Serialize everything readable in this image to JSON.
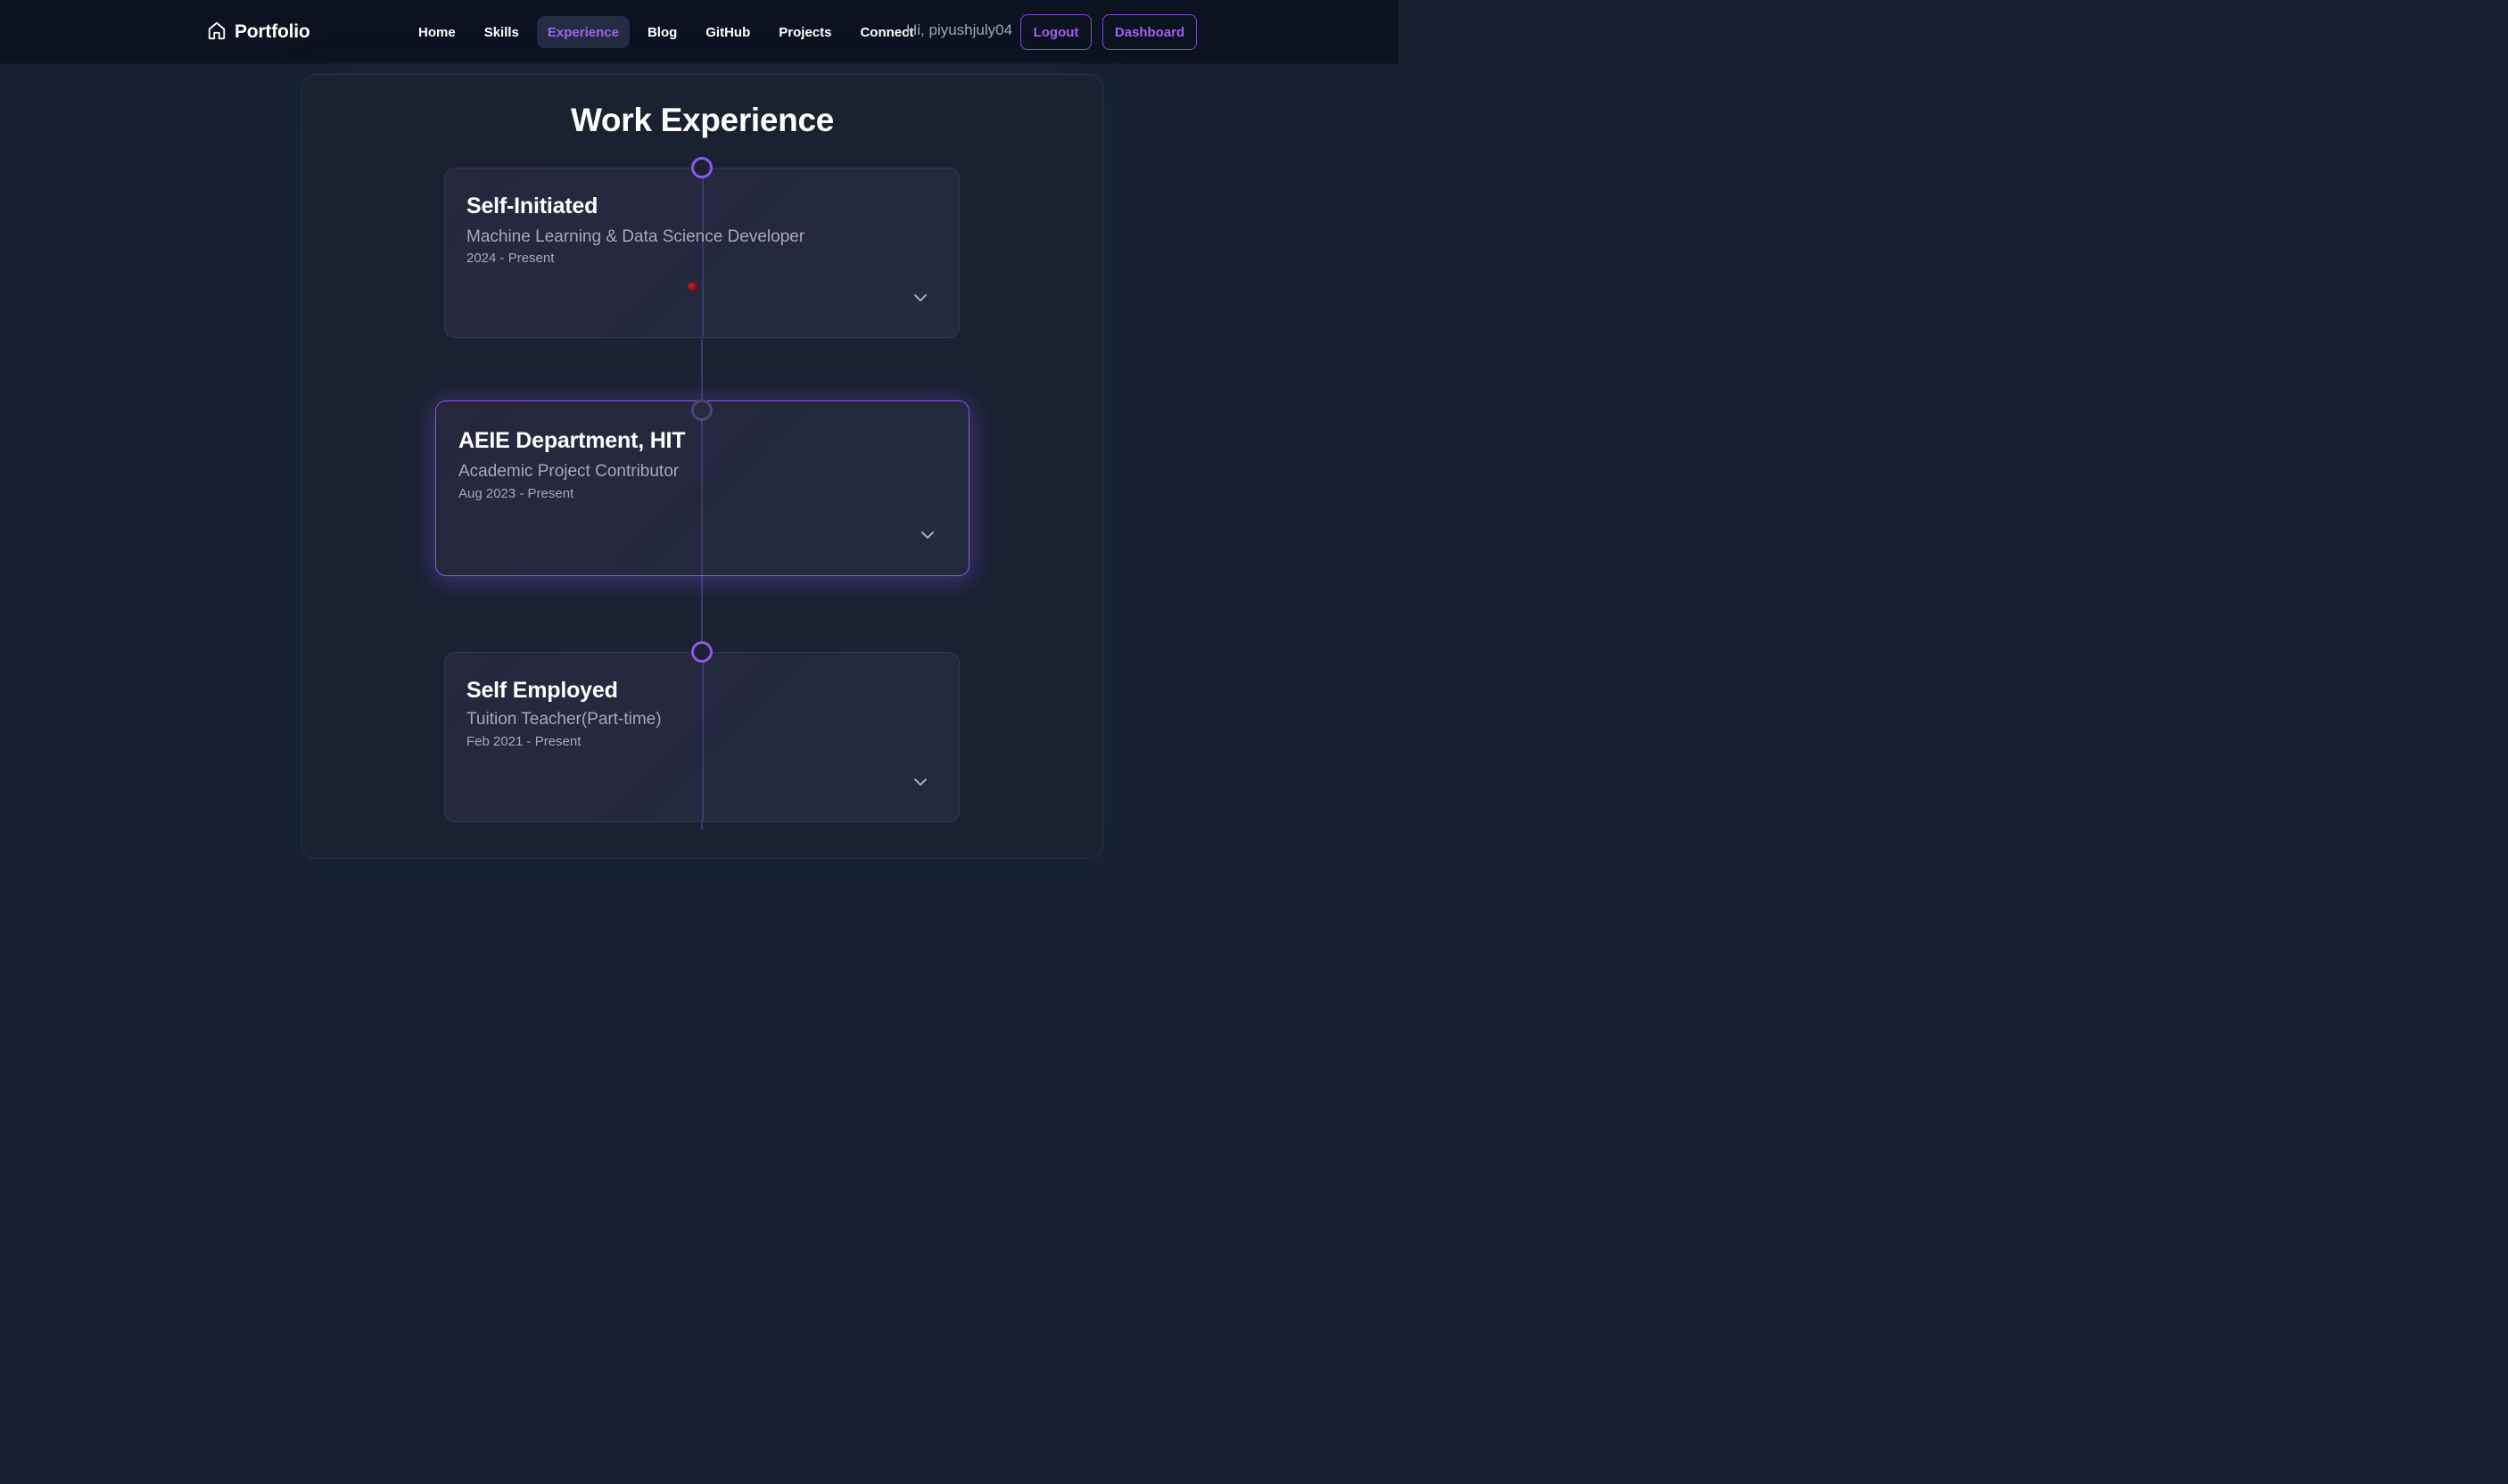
{
  "navbar": {
    "brand": {
      "label": "Portfolio",
      "icon": "home-icon"
    },
    "links": [
      {
        "label": "Home",
        "active": false
      },
      {
        "label": "Skills",
        "active": false
      },
      {
        "label": "Experience",
        "active": true
      },
      {
        "label": "Blog",
        "active": false
      },
      {
        "label": "GitHub",
        "active": false
      },
      {
        "label": "Projects",
        "active": false
      },
      {
        "label": "Connect",
        "active": false
      }
    ],
    "greeting": "Hi, piyushjuly04",
    "logout_label": "Logout",
    "dashboard_label": "Dashboard"
  },
  "main": {
    "title": "Work Experience",
    "experiences": [
      {
        "company": "Self-Initiated",
        "role": "Machine Learning & Data Science Developer",
        "period": "2024 - Present",
        "expand_icon": "chevron-down-icon"
      },
      {
        "company": "AEIE Department, HIT",
        "role": "Academic Project Contributor",
        "period": "Aug 2023 - Present",
        "expand_icon": "chevron-down-icon"
      },
      {
        "company": "Self Employed",
        "role": "Tuition Teacher(Part-time)",
        "period": "Feb 2021 - Present",
        "expand_icon": "chevron-down-icon"
      }
    ]
  },
  "colors": {
    "accent": "#a062ec",
    "background": "#172030",
    "navbar": "#0c1220",
    "card": "#25283d"
  }
}
